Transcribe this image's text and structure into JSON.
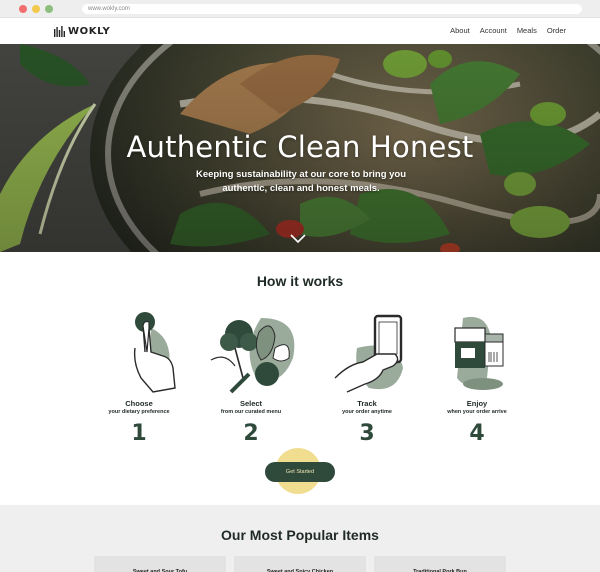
{
  "browser": {
    "url": "www.wokly.com",
    "dot_colors": [
      "#f06e6e",
      "#f2c94c",
      "#8bbf7e"
    ]
  },
  "nav": {
    "logo_text": "WOKLY",
    "links": [
      "About",
      "Account",
      "Meals",
      "Order"
    ]
  },
  "hero": {
    "title": "Authentic Clean Honest",
    "subtitle": "Keeping sustainability at our core to bring you authentic, clean and honest meals."
  },
  "how": {
    "title": "How it works",
    "steps": [
      {
        "title": "Choose",
        "desc": "your dietary preference",
        "number": "1",
        "icon": "hand-tap-icon"
      },
      {
        "title": "Select",
        "desc": "from our curated menu",
        "number": "2",
        "icon": "vegetables-icon"
      },
      {
        "title": "Track",
        "desc": "your order anytime",
        "number": "3",
        "icon": "phone-in-hand-icon"
      },
      {
        "title": "Enjoy",
        "desc": "when your order arrive",
        "number": "4",
        "icon": "delivery-box-icon"
      }
    ],
    "cta_label": "Get Started"
  },
  "popular": {
    "title": "Our Most Popular Items",
    "cards": [
      "Sweet and Sour Tofu",
      "Sweet and Spicy Chicken",
      "Traditional Pork Bun"
    ]
  },
  "colors": {
    "accent_green": "#2f4a3b",
    "highlight_yellow": "#efd77c",
    "muted_green": "#9aab9c"
  }
}
